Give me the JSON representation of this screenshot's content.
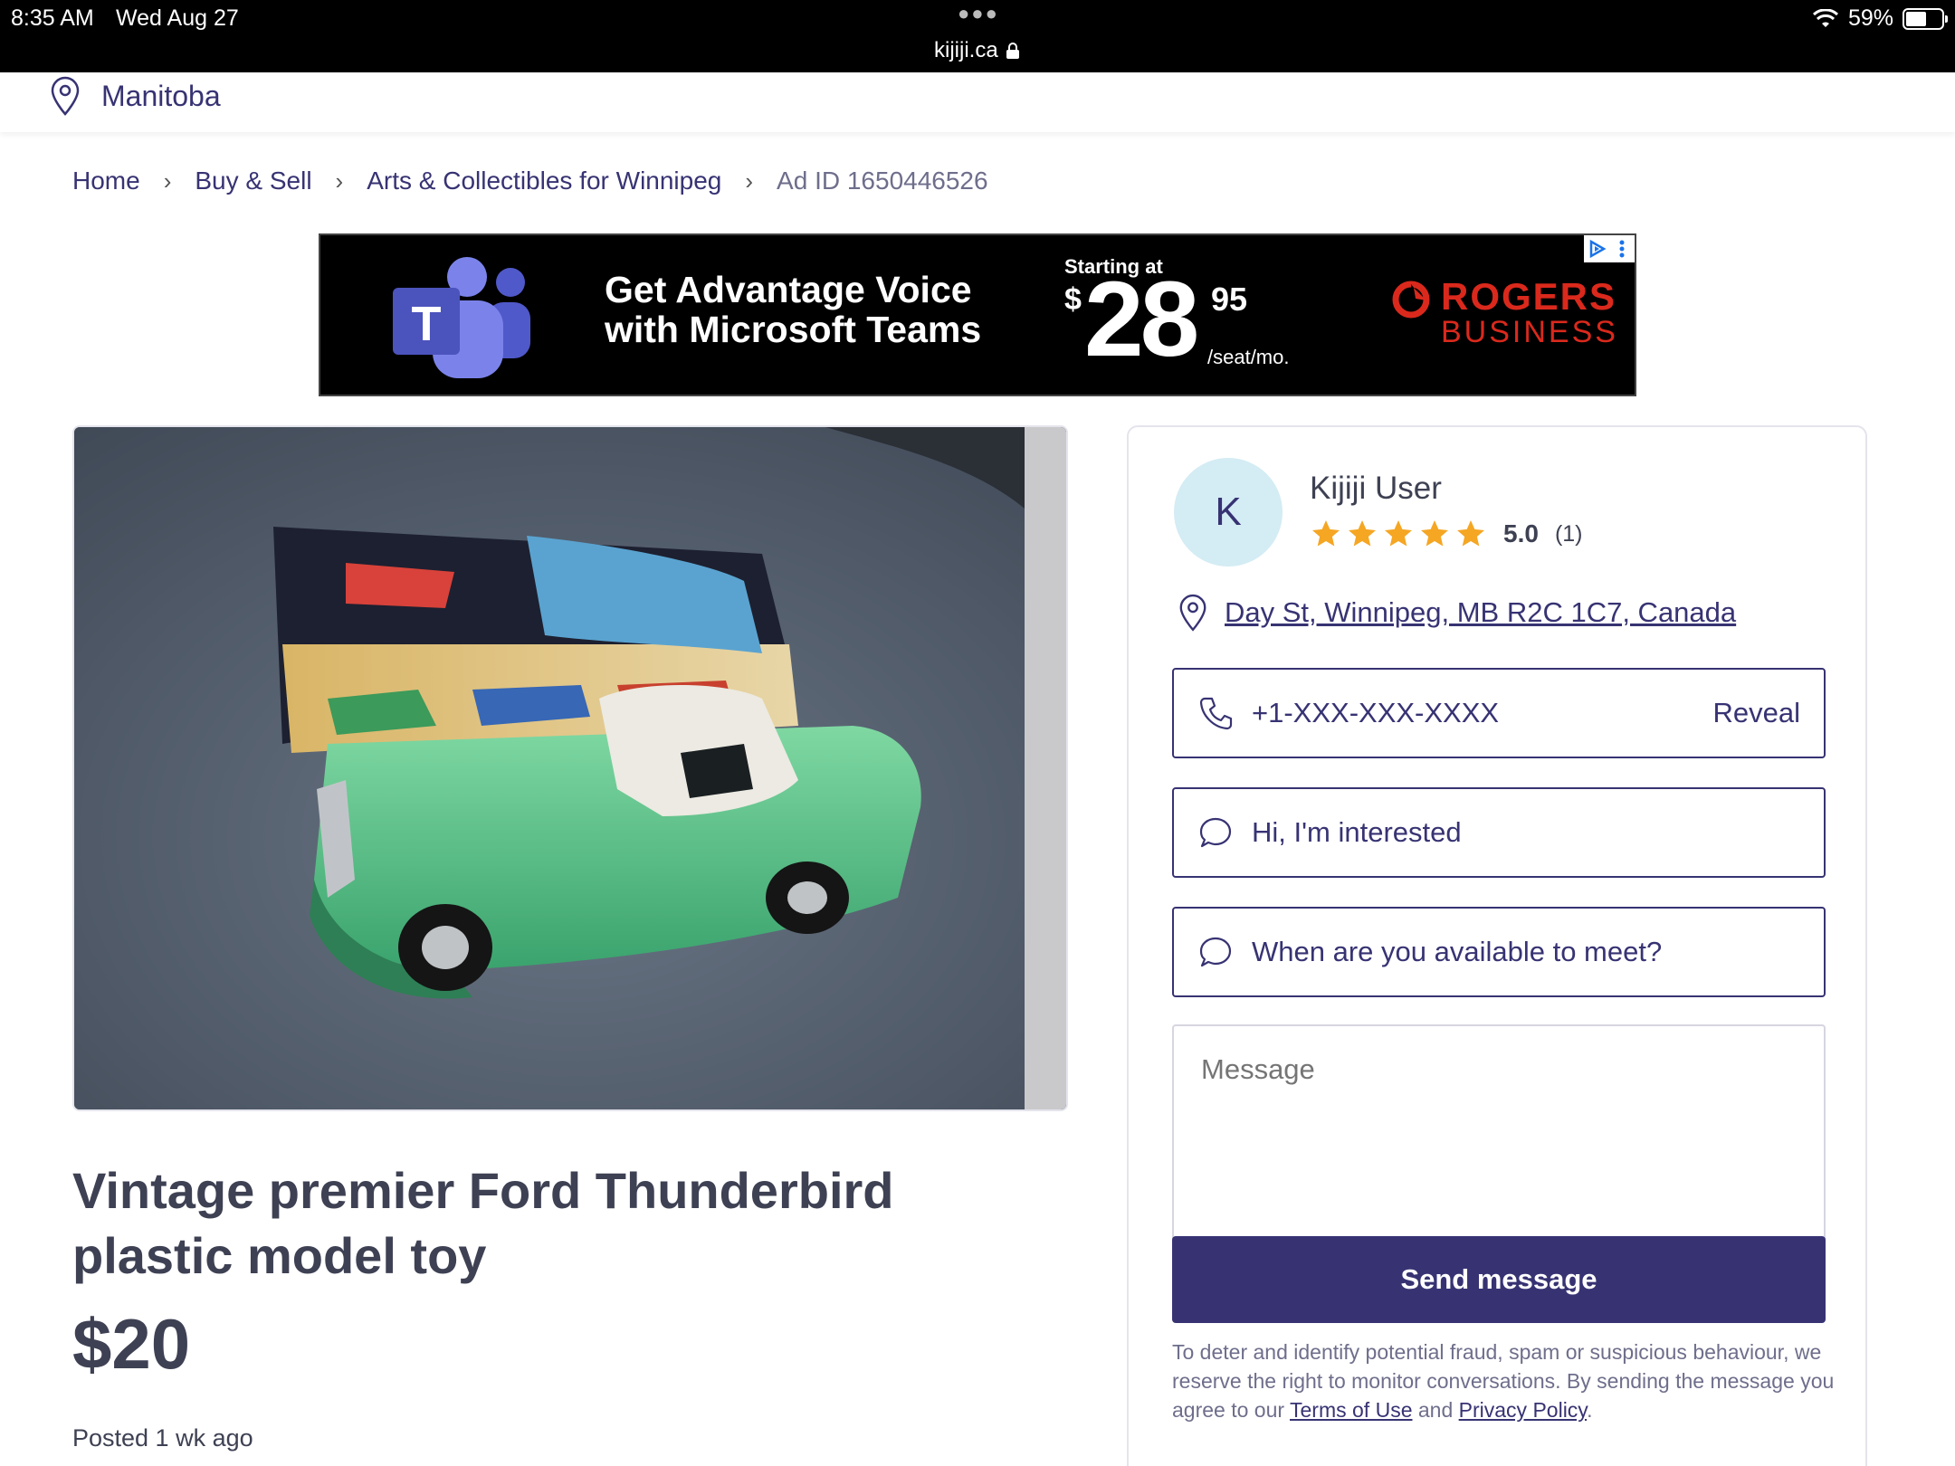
{
  "status_bar": {
    "time": "8:35 AM",
    "date": "Wed Aug 27",
    "url": "kijiji.ca",
    "battery": "59%",
    "battery_level": 0.59
  },
  "location": {
    "name": "Manitoba"
  },
  "breadcrumb": {
    "items": [
      "Home",
      "Buy & Sell",
      "Arts & Collectibles for Winnipeg"
    ],
    "current": "Ad ID 1650446526"
  },
  "ad": {
    "headline_line1": "Get Advantage Voice",
    "headline_line2": "with Microsoft Teams",
    "starting_at": "Starting at",
    "currency": "$",
    "price_main": "28",
    "price_cents": "95",
    "per": "/seat/mo.",
    "brand_line1": "ROGERS",
    "brand_line2": "BUSINESS",
    "teams_letter": "T"
  },
  "listing": {
    "title": "Vintage premier Ford Thunderbird plastic model toy",
    "price": "$20",
    "posted": "Posted 1 wk ago"
  },
  "seller": {
    "avatar_letter": "K",
    "name": "Kijiji User",
    "rating": "5.0",
    "rating_value": 5,
    "rating_count": "(1)",
    "address": "Day St, Winnipeg, MB R2C 1C7, Canada"
  },
  "contact": {
    "phone": "+1-XXX-XXX-XXXX",
    "reveal_label": "Reveal",
    "quick_reply_1": "Hi, I'm interested",
    "quick_reply_2": "When are you available to meet?",
    "message_placeholder": "Message",
    "send_label": "Send message",
    "disclaimer_text": "To deter and identify potential fraud, spam or suspicious behaviour, we reserve the right to monitor conversations. By sending the message you agree to our ",
    "terms_label": "Terms of Use",
    "and_text": " and ",
    "privacy_label": "Privacy Policy",
    "end_text": "."
  },
  "colors": {
    "brand": "#373373",
    "star": "#f5a623",
    "avatar_bg": "#d4ecf4",
    "rogers_red": "#da291c"
  },
  "icons": [
    "location-pin-icon",
    "chevron-right-icon",
    "phone-icon",
    "chat-bubble-icon",
    "star-icon",
    "wifi-icon",
    "lock-icon",
    "battery-icon",
    "adchoices-icon",
    "kebab-menu-icon",
    "teams-logo",
    "rogers-logo"
  ]
}
